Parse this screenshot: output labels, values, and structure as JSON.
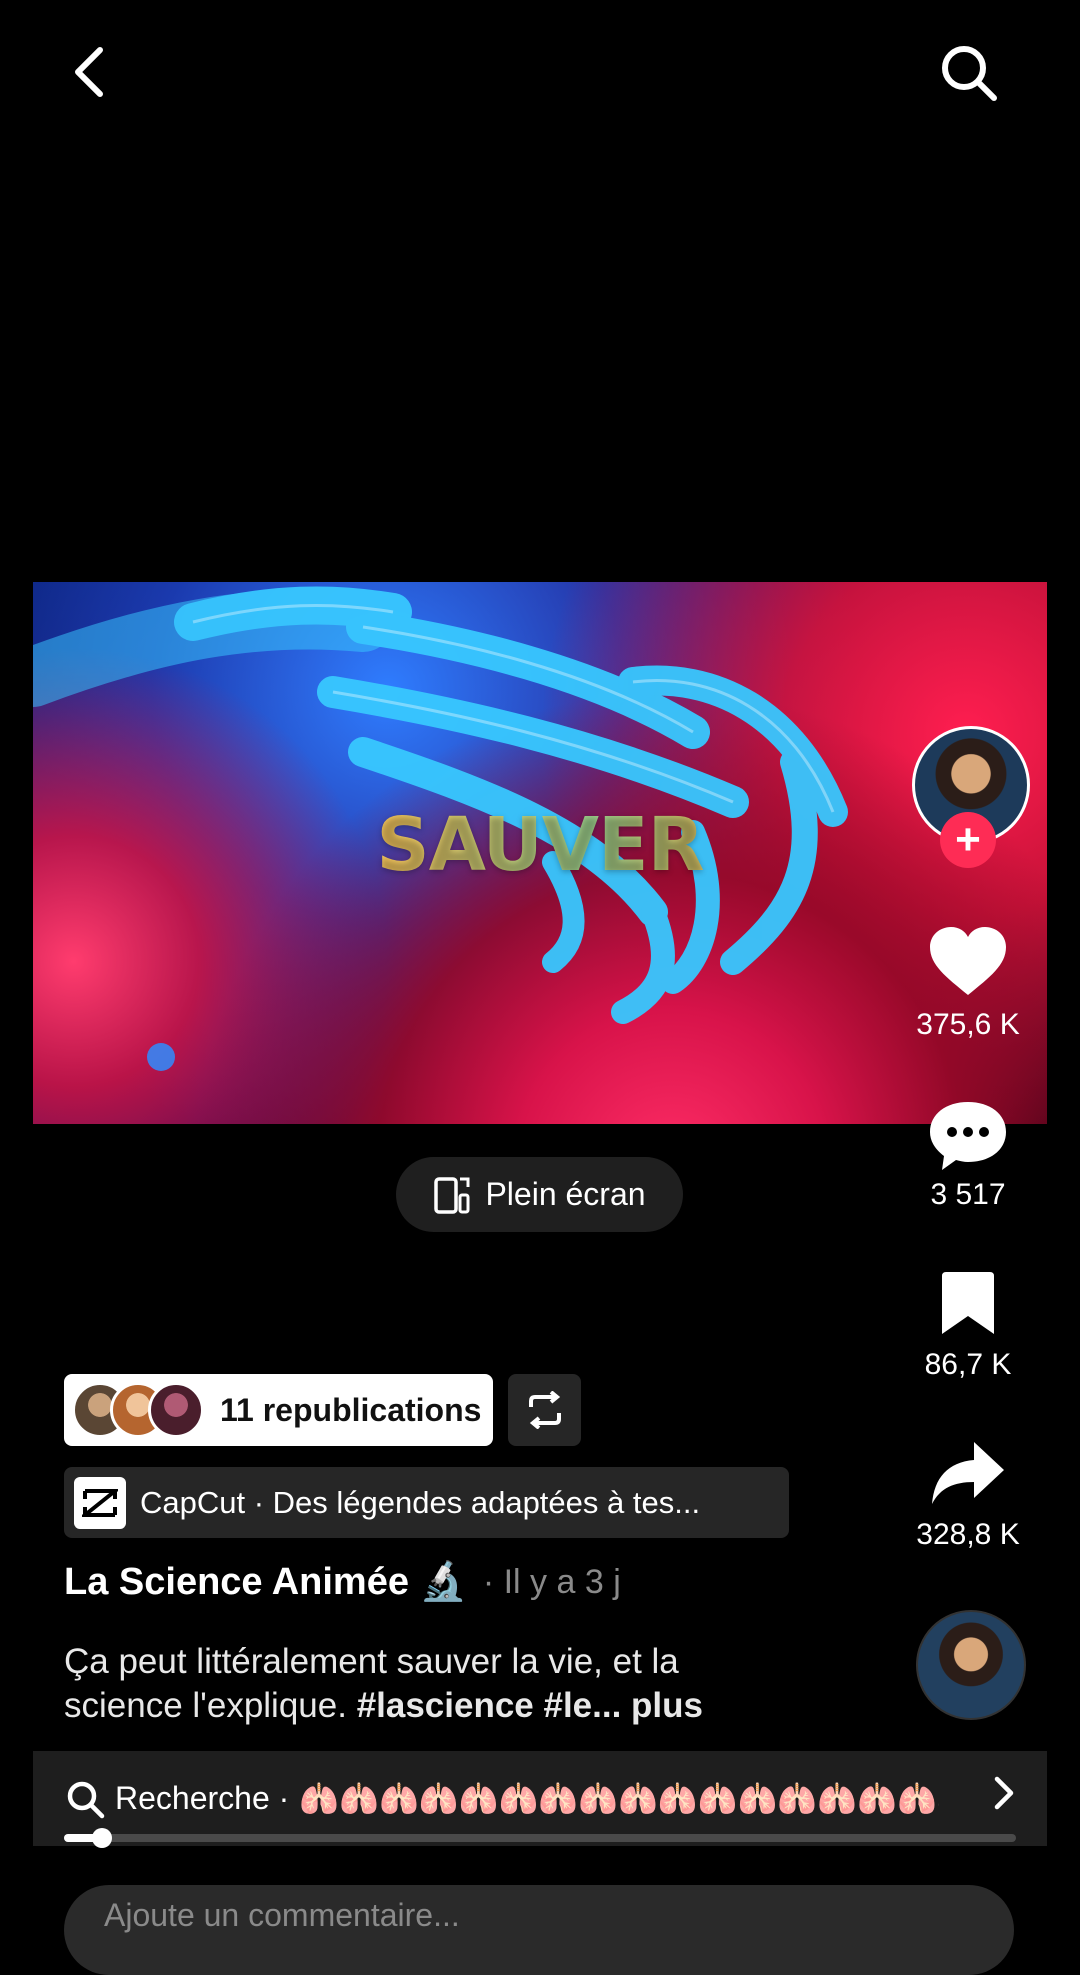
{
  "top_bar": {
    "back_icon": "chevron-left-icon",
    "search_icon": "search-icon"
  },
  "video": {
    "overlay_text": "SAUVER"
  },
  "rail": {
    "likes": "375,6 K",
    "comments": "3 517",
    "saves": "86,7 K",
    "shares": "328,8 K",
    "follow_symbol": "+"
  },
  "fullscreen": {
    "label": "Plein écran"
  },
  "republications": {
    "label": "11 republications"
  },
  "capcut": {
    "label": "CapCut · Des légendes adaptées à tes..."
  },
  "post": {
    "author": "La Science Animée 🔬",
    "time": "· Il y a 3 j",
    "caption_text": "Ça peut littéralement sauver la vie, et la science l'explique. ",
    "caption_tags": "#lascience #le...",
    "more": " plus"
  },
  "search": {
    "label": "Recherche ·",
    "suggestion": "🫁🫁🫁🫁🫁🫁🫁🫁🫁🫁🫁🫁🫁🫁🫁🫁🫁🫁🫁🫁🫁...",
    "progress": 0.04
  },
  "comment_input": {
    "placeholder": "Ajoute un commentaire..."
  },
  "colors": {
    "accent": "#fe2c55",
    "background": "#000000"
  }
}
